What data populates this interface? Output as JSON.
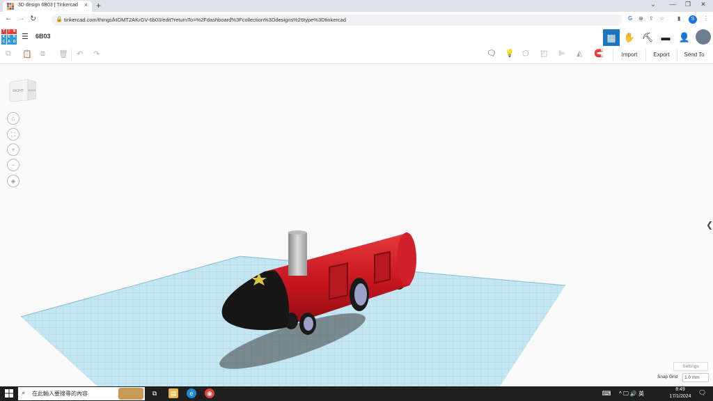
{
  "browser": {
    "tab_title": "3D design 6B03 | Tinkercad",
    "tab_close": "×",
    "new_tab": "+",
    "url": "tinkercad.com/things/kIDMT2AKrGV-6b03/edit?returnTo=%2Fdashboard%3Fcollection%3Ddesigns%26type%3Dtinkercad",
    "profile_initial": "S",
    "window_controls": [
      "⌄",
      "—",
      "❐",
      "✕"
    ]
  },
  "app": {
    "logo_letters": [
      "T",
      "I",
      "N",
      "K",
      "E",
      "R",
      "C",
      "A",
      "D"
    ],
    "design_name": "6B03"
  },
  "toolbar": {
    "import_label": "Import",
    "export_label": "Export",
    "send_to_label": "Send To"
  },
  "view_cube": {
    "front_label": "RIGHT",
    "side_label": "BACK"
  },
  "workplane": {
    "settings_label": "Settings",
    "snap_grid_label": "Snap Grid",
    "snap_grid_value": "1.0 mm"
  },
  "taskbar": {
    "search_placeholder": "在此輸入要搜尋的內容",
    "tray_language": "英",
    "time": "8:49",
    "date": "17/1/2024"
  },
  "colors": {
    "accent": "#1e73be",
    "train_body": "#d0212b",
    "nose": "#161616",
    "grid": "#a7d9ea"
  }
}
